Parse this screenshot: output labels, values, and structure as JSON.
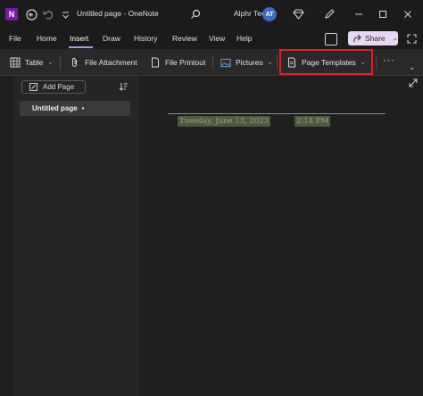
{
  "titlebar": {
    "app_icon_letter": "N",
    "title": "Untitled page - OneNote",
    "user_name": "Alphr Tech",
    "avatar_initials": "AT"
  },
  "menu": {
    "items": [
      "File",
      "Home",
      "Insert",
      "Draw",
      "History",
      "Review",
      "View",
      "Help"
    ],
    "active": "Insert",
    "share_label": "Share"
  },
  "ribbon": {
    "table": "Table",
    "file_attachment": "File Attachment",
    "file_printout": "File Printout",
    "pictures": "Pictures",
    "page_templates": "Page Templates",
    "more": "···"
  },
  "sidebar": {
    "add_page": "Add Page",
    "pages": [
      {
        "title": "Untitled page",
        "marker": "•"
      }
    ]
  },
  "page": {
    "date": "Tuesday, June 13, 2023",
    "time": "2:14 PM"
  },
  "colors": {
    "accent": "#b392f0",
    "highlight_box": "#e02020",
    "share_bg": "#e6d8f5",
    "avatar": "#3a6cc6"
  }
}
